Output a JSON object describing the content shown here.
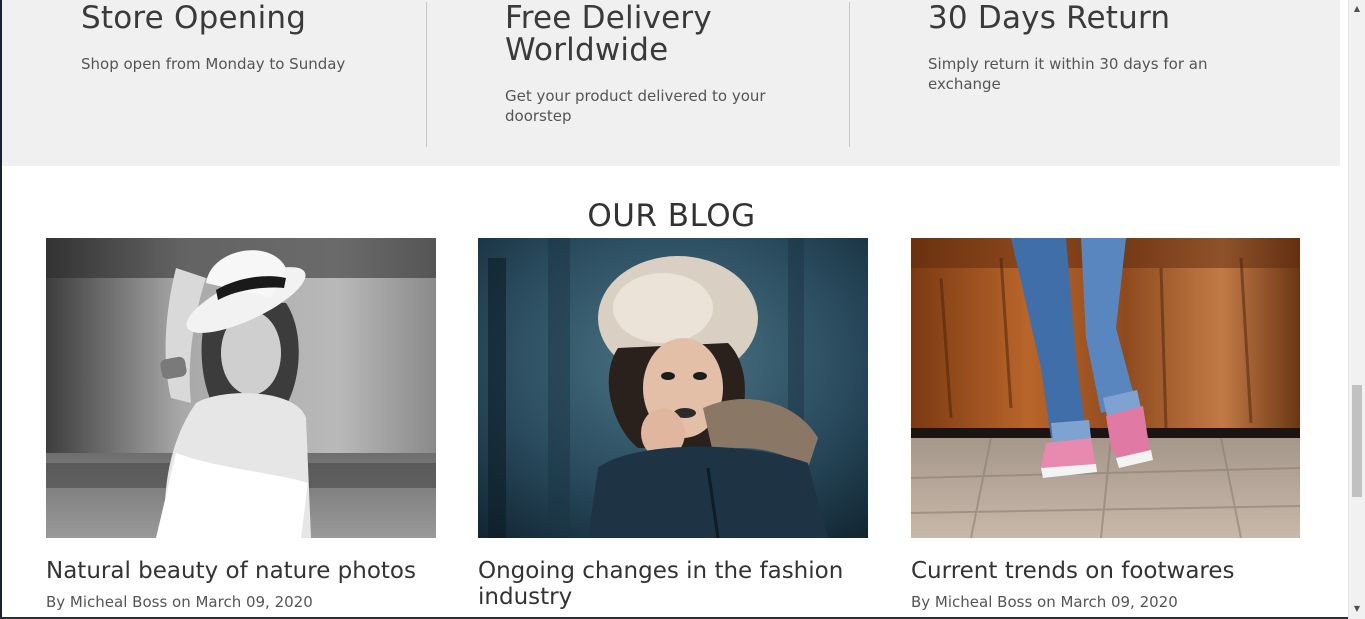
{
  "features": [
    {
      "title": "Store Opening",
      "text": "Shop open from Monday to Sunday"
    },
    {
      "title": "Free Delivery Worldwide",
      "text": "Get your product delivered to your doorstep"
    },
    {
      "title": "30 Days Return",
      "text": "Simply return it within 30 days for an exchange"
    }
  ],
  "blog": {
    "heading": "OUR BLOG",
    "posts": [
      {
        "title": "Natural beauty of nature photos",
        "meta": "By Micheal Boss on March 09, 2020",
        "image": "woman-in-white-hat-photo"
      },
      {
        "title": "Ongoing changes in the fashion industry",
        "meta": "",
        "image": "woman-in-fur-hood-photo"
      },
      {
        "title": "Current trends on footwares",
        "meta": "By Micheal Boss on March 09, 2020",
        "image": "jeans-and-pink-sneakers-photo"
      }
    ]
  },
  "scrollbar": {
    "up_icon": "scroll-up-arrow-icon",
    "down_icon": "scroll-down-arrow-icon"
  }
}
